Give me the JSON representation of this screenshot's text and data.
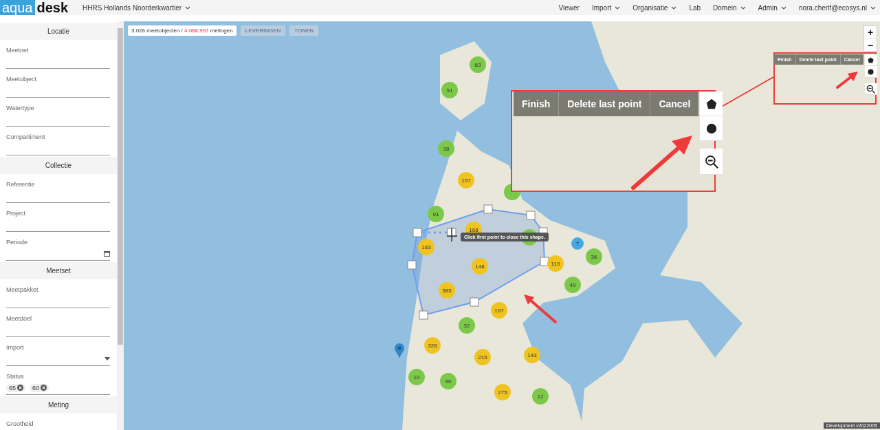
{
  "header": {
    "logo": {
      "part_1": "aqua",
      "part_2": "desk"
    },
    "organisation": "HHRS Hollands Noorderkwartier",
    "nav": [
      {
        "label": "Viewer",
        "dropdown": false
      },
      {
        "label": "Import",
        "dropdown": true
      },
      {
        "label": "Organisatie",
        "dropdown": true
      },
      {
        "label": "Lab",
        "dropdown": false
      },
      {
        "label": "Domein",
        "dropdown": true
      },
      {
        "label": "Admin",
        "dropdown": true
      },
      {
        "label": "nora.cherif@ecosys.nl",
        "dropdown": true
      }
    ]
  },
  "sidebar": {
    "sections": [
      {
        "title": "Locatie",
        "fields": [
          {
            "label": "Meetnet",
            "kind": "text"
          },
          {
            "label": "Meetobject",
            "kind": "text"
          },
          {
            "label": "Watertype",
            "kind": "text"
          },
          {
            "label": "Compartiment",
            "kind": "text"
          }
        ]
      },
      {
        "title": "Collectie",
        "fields": [
          {
            "label": "Referentie",
            "kind": "text"
          },
          {
            "label": "Project",
            "kind": "text"
          },
          {
            "label": "Periode",
            "kind": "date"
          }
        ]
      },
      {
        "title": "Meetset",
        "fields": [
          {
            "label": "Meetpakket",
            "kind": "text"
          },
          {
            "label": "Meetdoel",
            "kind": "text"
          },
          {
            "label": "Import",
            "kind": "select"
          },
          {
            "label": "Status",
            "kind": "chips",
            "chips": [
              "65",
              "60"
            ]
          }
        ]
      },
      {
        "title": "Meting",
        "fields": [
          {
            "label": "Grootheid",
            "kind": "text"
          }
        ]
      }
    ]
  },
  "map": {
    "summary": {
      "objects": "3.026",
      "objects_label": "meetobjecten /",
      "measurements": "4.088.997",
      "measurements_label": "metingen"
    },
    "buttons": [
      {
        "label": "LEVERINGEN",
        "disabled": true
      },
      {
        "label": "TONEN",
        "disabled": true
      }
    ],
    "zoom_controls": [
      "+",
      "−"
    ],
    "clusters": [
      {
        "count": "83",
        "color": "#7cc94a"
      },
      {
        "count": "51",
        "color": "#7cc94a"
      },
      {
        "count": "38",
        "color": "#7cc94a"
      },
      {
        "count": "157",
        "color": "#f0c420"
      },
      {
        "color": "#7cc94a"
      },
      {
        "count": "91",
        "color": "#7cc94a"
      },
      {
        "count": "168",
        "color": "#f0c420"
      },
      {
        "color": "#7cc94a"
      },
      {
        "count": "183",
        "color": "#f0c420"
      },
      {
        "count": "7",
        "color": "#45a8e0"
      },
      {
        "count": "36",
        "color": "#7cc94a"
      },
      {
        "count": "148",
        "color": "#f0c420"
      },
      {
        "count": "110",
        "color": "#f0c420"
      },
      {
        "count": "385",
        "color": "#f0c420"
      },
      {
        "count": "49",
        "color": "#7cc94a"
      },
      {
        "count": "197",
        "color": "#f0c420"
      },
      {
        "count": "32",
        "color": "#7cc94a"
      },
      {
        "count": "328",
        "color": "#f0c420"
      },
      {
        "count": "215",
        "color": "#f0c420"
      },
      {
        "count": "143",
        "color": "#f0c420"
      },
      {
        "count": "10",
        "color": "#7cc94a"
      },
      {
        "count": "90",
        "color": "#7cc94a"
      },
      {
        "count": "275",
        "color": "#f0c420"
      },
      {
        "count": "12",
        "color": "#7cc94a"
      }
    ],
    "tooltip": "Click first point to close this shape.",
    "draw_actions": [
      "Finish",
      "Delete last point",
      "Cancel"
    ],
    "inset": {
      "draw_actions": [
        "Finish",
        "Delete last point",
        "Cancel"
      ]
    },
    "footer": "Development v2022005"
  }
}
